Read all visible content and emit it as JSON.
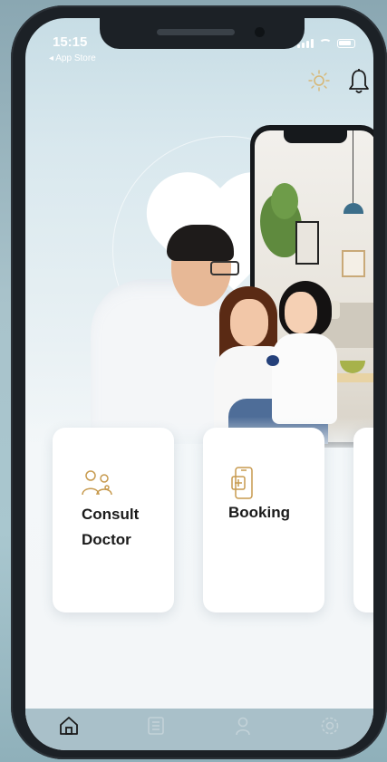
{
  "status_bar": {
    "time": "15:15",
    "back_label": "◂ App Store"
  },
  "header": {
    "icons": [
      "sun-icon",
      "bell-icon"
    ]
  },
  "cards": [
    {
      "label_line1": "Consult",
      "label_line2": "Doctor",
      "icon": "doctor-family-icon"
    },
    {
      "label_line1": "Booking",
      "icon": "mobile-booking-icon"
    },
    {
      "icon": "partial-card-icon"
    }
  ],
  "tab_bar": {
    "tabs": [
      {
        "icon": "home-icon",
        "active": true
      },
      {
        "icon": "list-icon",
        "active": false
      },
      {
        "icon": "person-icon",
        "active": false
      },
      {
        "icon": "settings-icon",
        "active": false
      }
    ]
  },
  "colors": {
    "accent": "#c79a4e",
    "tabbar": "#a9c0c9",
    "active_icon": "#1a1a1a",
    "inactive_icon": "#c3d2d8"
  }
}
